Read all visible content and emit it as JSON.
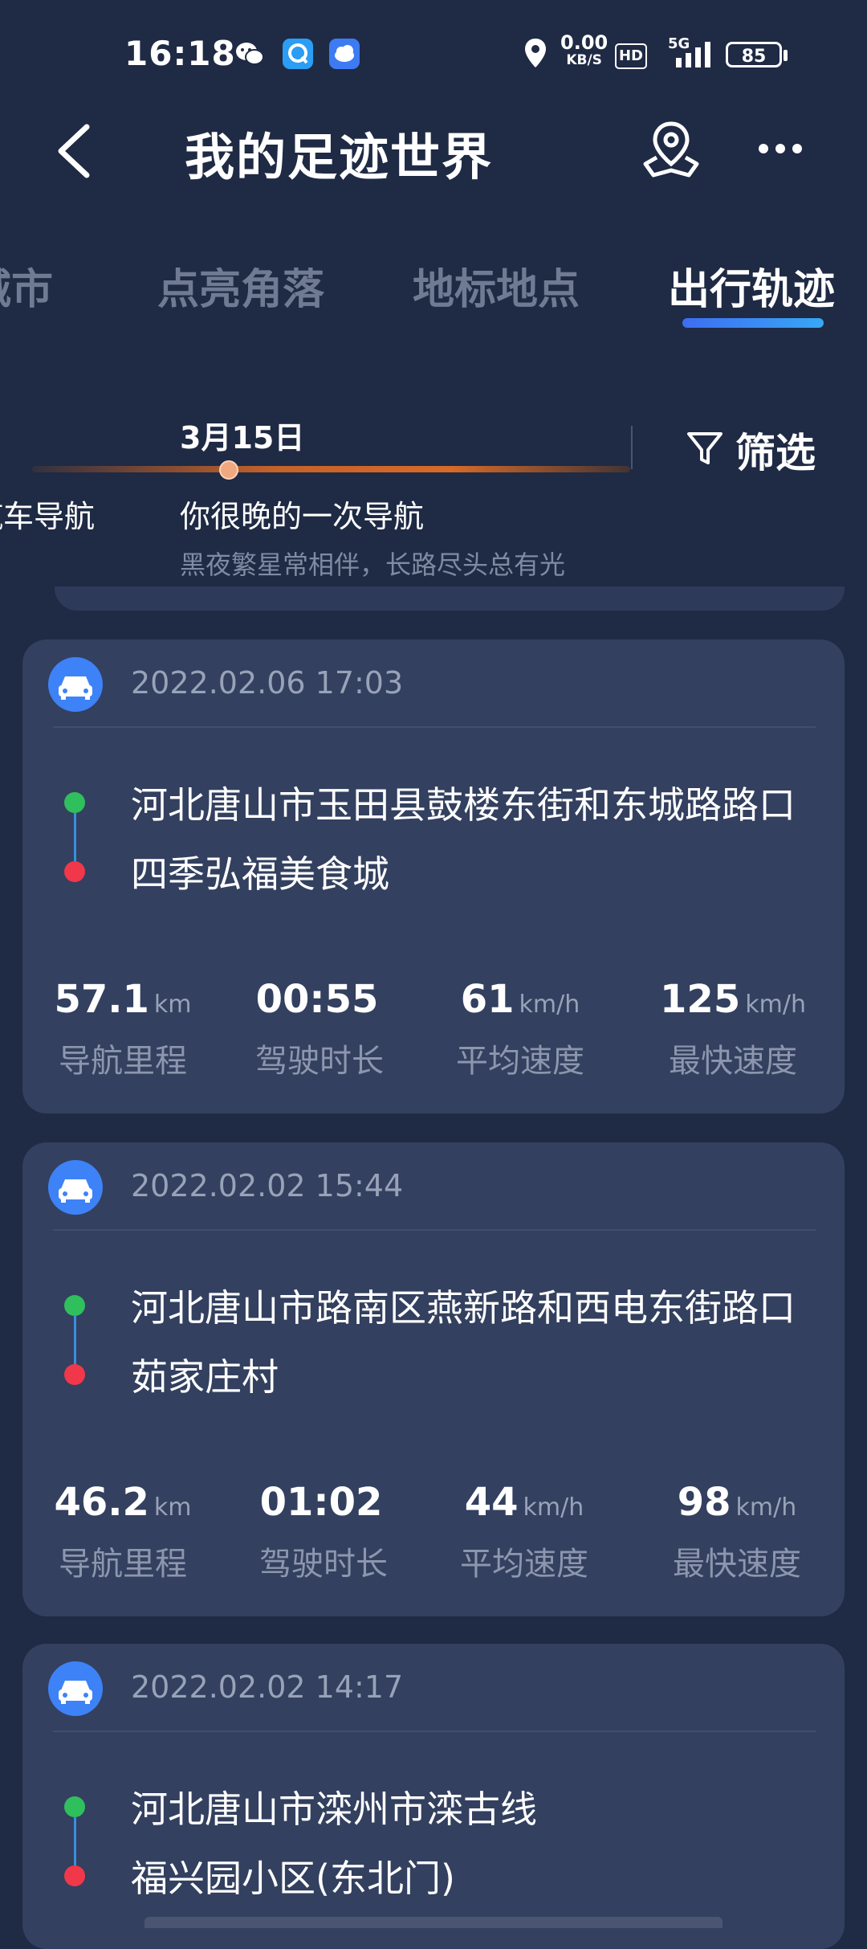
{
  "status_bar": {
    "time": "16:18",
    "net_speed_value": "0.00",
    "net_speed_unit": "KB/S",
    "hd": "HD",
    "network": "5G",
    "battery": "85",
    "icons": [
      "wechat-icon",
      "q-app-icon",
      "cloud-icon",
      "location-icon",
      "signal-icon",
      "battery-icon"
    ]
  },
  "header": {
    "title": "我的足迹世界",
    "icons": [
      "back-icon",
      "map-pin-icon",
      "more-icon"
    ]
  },
  "tabs": [
    {
      "label": "城市"
    },
    {
      "label": "点亮角落"
    },
    {
      "label": "地标地点"
    },
    {
      "label": "出行轨迹",
      "active": true
    }
  ],
  "timeline": {
    "date": "3月15日",
    "prev_title": "汽车导航",
    "current_title": "你很晚的一次导航",
    "current_sub": "黑夜繁星常相伴，长路尽头总有光",
    "filter_label": "筛选"
  },
  "trips": [
    {
      "time": "2022.02.06 17:03",
      "start": "河北唐山市玉田县鼓楼东街和东城路路口",
      "end": "四季弘福美食城",
      "stats": [
        {
          "value": "57.1",
          "unit": "km",
          "label": "导航里程"
        },
        {
          "value": "00:55",
          "unit": "",
          "label": "驾驶时长"
        },
        {
          "value": "61",
          "unit": "km/h",
          "label": "平均速度"
        },
        {
          "value": "125",
          "unit": "km/h",
          "label": "最快速度"
        }
      ]
    },
    {
      "time": "2022.02.02 15:44",
      "start": "河北唐山市路南区燕新路和西电东街路口",
      "end": "茹家庄村",
      "stats": [
        {
          "value": "46.2",
          "unit": "km",
          "label": "导航里程"
        },
        {
          "value": "01:02",
          "unit": "",
          "label": "驾驶时长"
        },
        {
          "value": "44",
          "unit": "km/h",
          "label": "平均速度"
        },
        {
          "value": "98",
          "unit": "km/h",
          "label": "最快速度"
        }
      ]
    },
    {
      "time": "2022.02.02 14:17",
      "start": "河北唐山市滦州市滦古线",
      "end": "福兴园小区(东北门)"
    }
  ],
  "colors": {
    "background": "#1f2a44",
    "card": "#33405f",
    "accent_blue": "#3e82f7",
    "start_green": "#2fbf5d",
    "end_red": "#f0384a",
    "timeline_orange": "#d86a28"
  }
}
